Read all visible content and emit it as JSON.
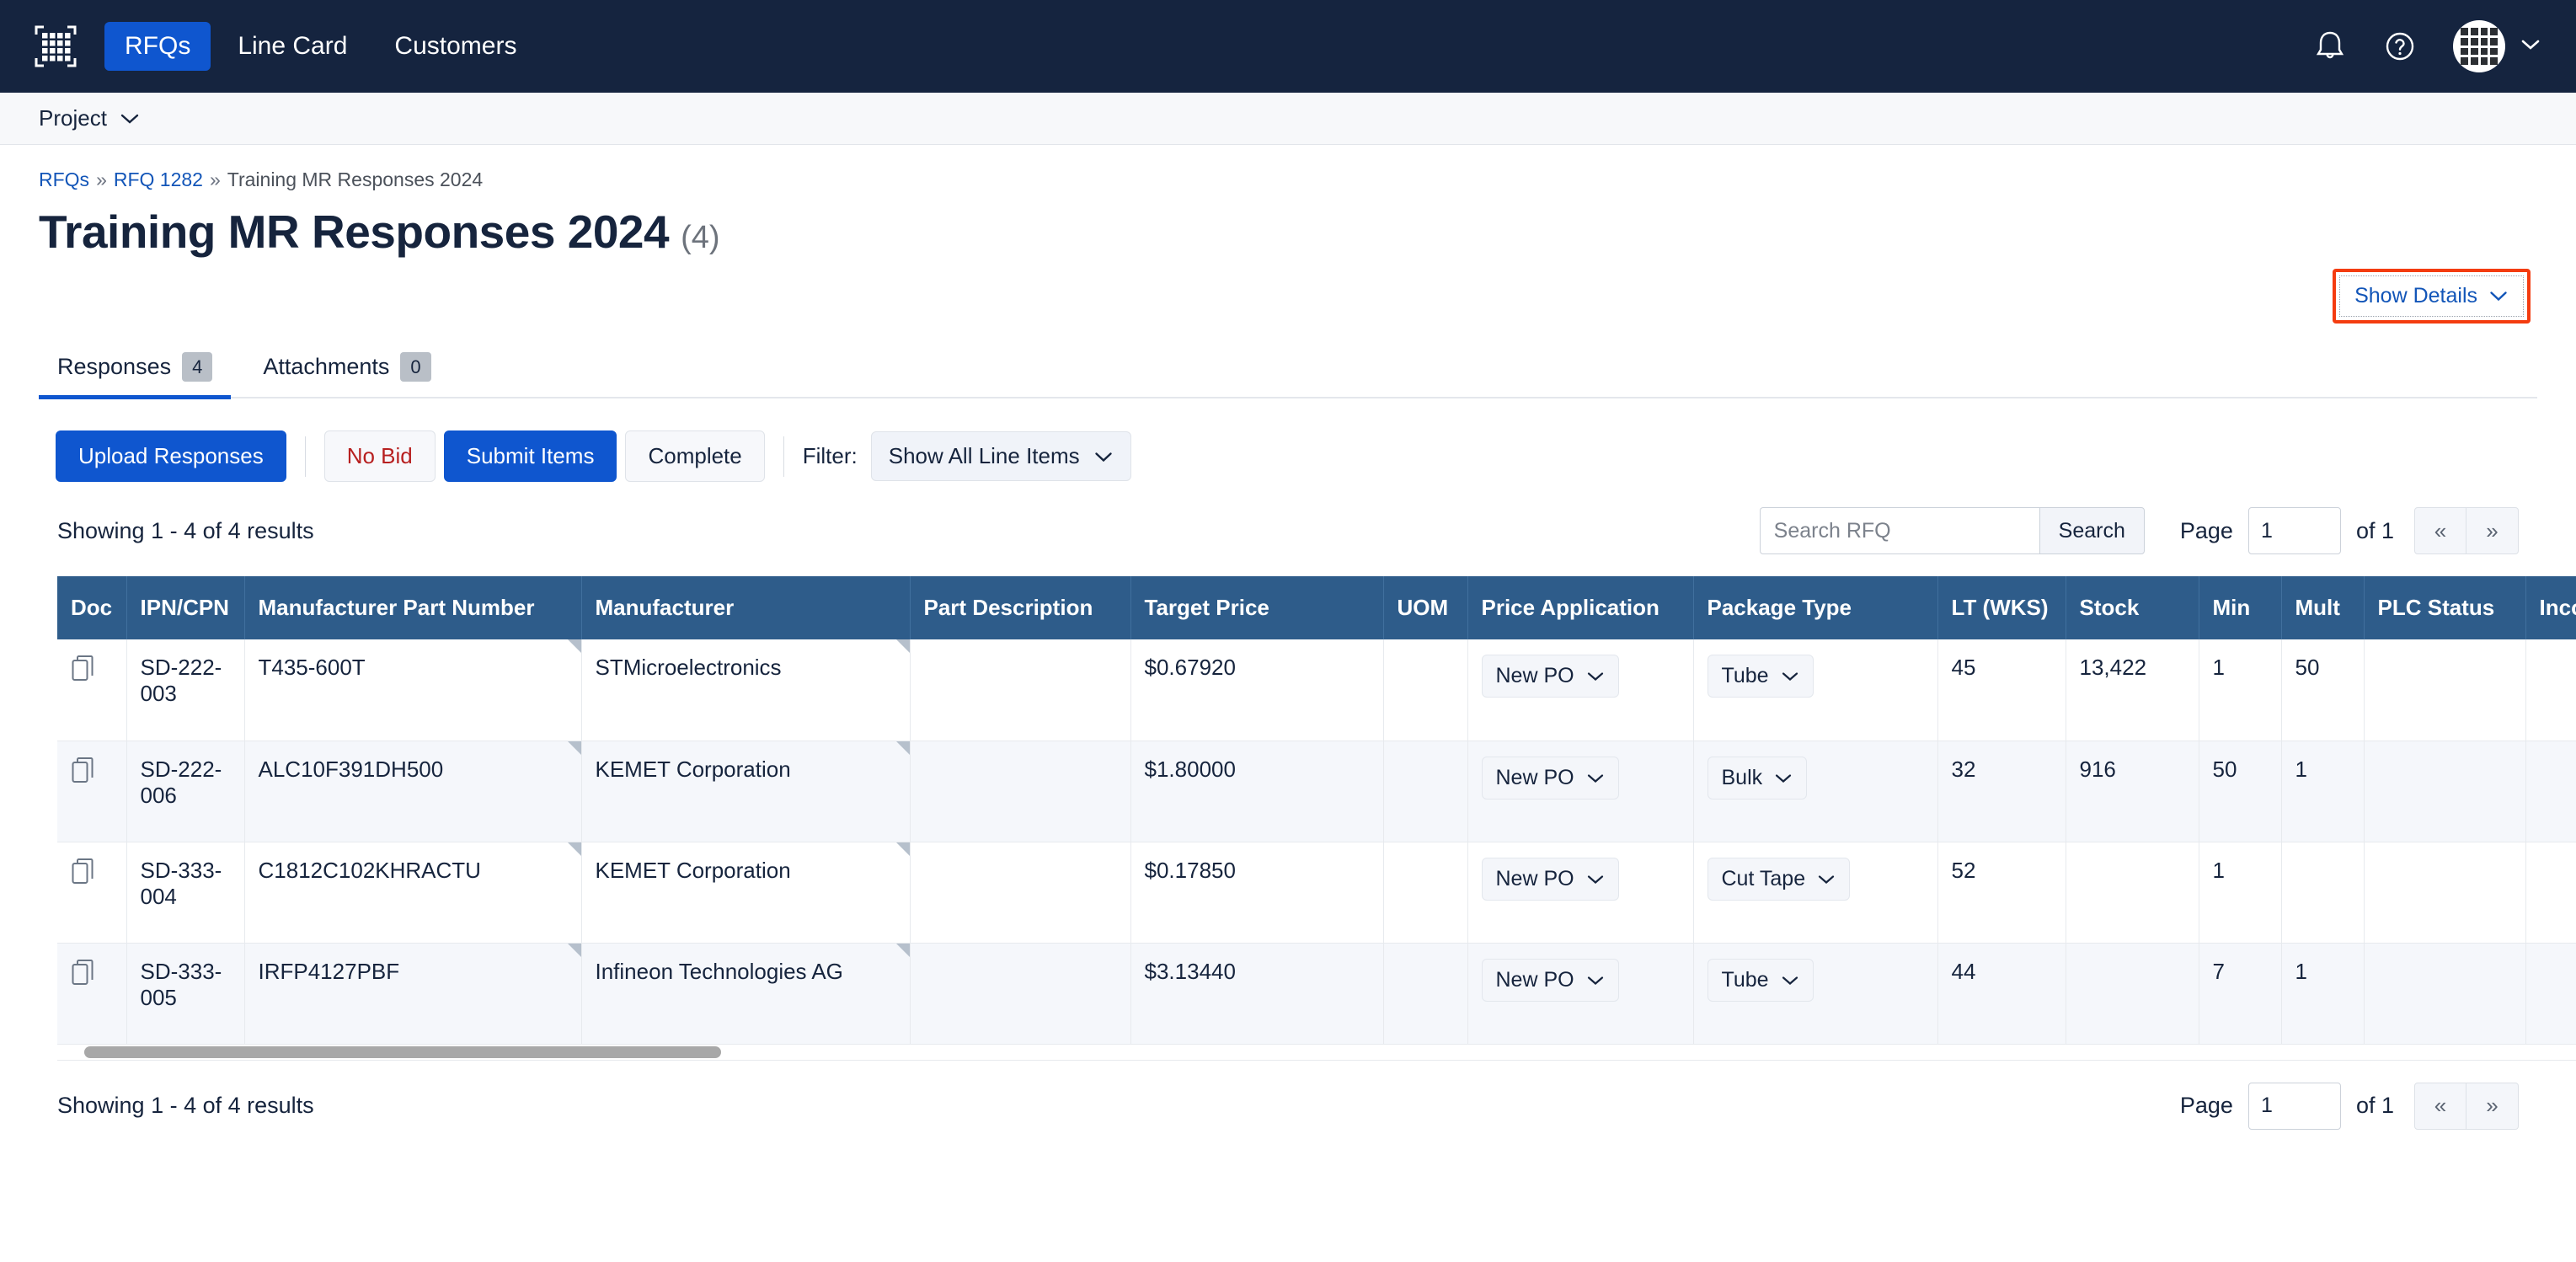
{
  "topnav": {
    "logo_icon": "grid-logo-icon",
    "links": [
      {
        "label": "RFQs",
        "active": true
      },
      {
        "label": "Line Card",
        "active": false
      },
      {
        "label": "Customers",
        "active": false
      }
    ],
    "bell_icon": "bell-icon",
    "help_icon": "help-circle-icon",
    "avatar_icon": "grid-avatar-icon",
    "avatar_chevron": "chevron-down-icon"
  },
  "projectbar": {
    "label": "Project",
    "chevron": "chevron-down-icon"
  },
  "breadcrumb": {
    "item1": "RFQs",
    "sep1": "»",
    "item2": "RFQ 1282",
    "sep2": "»",
    "item3": "Training MR Responses 2024"
  },
  "header": {
    "title": "Training MR Responses 2024",
    "count": "(4)",
    "show_details_label": "Show Details",
    "show_details_chevron": "chevron-down-icon"
  },
  "tabs": [
    {
      "label": "Responses",
      "badge": "4",
      "active": true
    },
    {
      "label": "Attachments",
      "badge": "0",
      "active": false
    }
  ],
  "toolbar": {
    "upload_label": "Upload Responses",
    "no_bid_label": "No Bid",
    "submit_label": "Submit Items",
    "complete_label": "Complete",
    "filter_label": "Filter:",
    "filter_value": "Show All Line Items",
    "filter_chevron": "chevron-down-icon"
  },
  "results": {
    "showing_text": "Showing 1 - 4 of 4 results",
    "search_placeholder": "Search RFQ",
    "search_value": "",
    "search_button": "Search",
    "page_label": "Page",
    "page_value": "1",
    "of_label": "of 1",
    "prev_label": "«",
    "next_label": "»"
  },
  "footer": {
    "showing_text": "Showing 1 - 4 of 4 results",
    "page_label": "Page",
    "page_value": "1",
    "of_label": "of 1",
    "prev_label": "«",
    "next_label": "»"
  },
  "table": {
    "columns": [
      "Doc",
      "IPN/CPN",
      "Manufacturer Part Number",
      "Manufacturer",
      "Part Description",
      "Target Price",
      "UOM",
      "Price Application",
      "Package Type",
      "LT (WKS)",
      "Stock",
      "Min",
      "Mult",
      "PLC Status",
      "Incoterms"
    ],
    "rows": [
      {
        "doc_icon": "copy-document-icon",
        "ipn": "SD-222-003",
        "mpn": "T435-600T",
        "manufacturer": "STMicroelectronics",
        "part_description": "",
        "target_price": "$0.67920",
        "uom": "",
        "price_application": "New PO",
        "package_type": "Tube",
        "lt_wks": "45",
        "stock": "13,422",
        "min": "1",
        "mult": "50",
        "plc_status": "",
        "incoterms": ""
      },
      {
        "doc_icon": "copy-document-icon",
        "ipn": "SD-222-006",
        "mpn": "ALC10F391DH500",
        "manufacturer": "KEMET Corporation",
        "part_description": "",
        "target_price": "$1.80000",
        "uom": "",
        "price_application": "New PO",
        "package_type": "Bulk",
        "lt_wks": "32",
        "stock": "916",
        "min": "50",
        "mult": "1",
        "plc_status": "",
        "incoterms": ""
      },
      {
        "doc_icon": "copy-document-icon",
        "ipn": "SD-333-004",
        "mpn": "C1812C102KHRACTU",
        "manufacturer": "KEMET Corporation",
        "part_description": "",
        "target_price": "$0.17850",
        "uom": "",
        "price_application": "New PO",
        "package_type": "Cut Tape",
        "lt_wks": "52",
        "stock": "",
        "min": "1",
        "mult": "",
        "plc_status": "",
        "incoterms": ""
      },
      {
        "doc_icon": "copy-document-icon",
        "ipn": "SD-333-005",
        "mpn": "IRFP4127PBF",
        "manufacturer": "Infineon Technologies AG",
        "part_description": "",
        "target_price": "$3.13440",
        "uom": "",
        "price_application": "New PO",
        "package_type": "Tube",
        "lt_wks": "44",
        "stock": "",
        "min": "7",
        "mult": "1",
        "plc_status": "",
        "incoterms": ""
      }
    ]
  },
  "colors": {
    "nav_bg": "#15243f",
    "accent_blue": "#0f56cf",
    "link_blue": "#1255b8",
    "table_header_bg": "#2e5c8a",
    "highlight_red": "#f43c10",
    "danger_text": "#b72020"
  }
}
